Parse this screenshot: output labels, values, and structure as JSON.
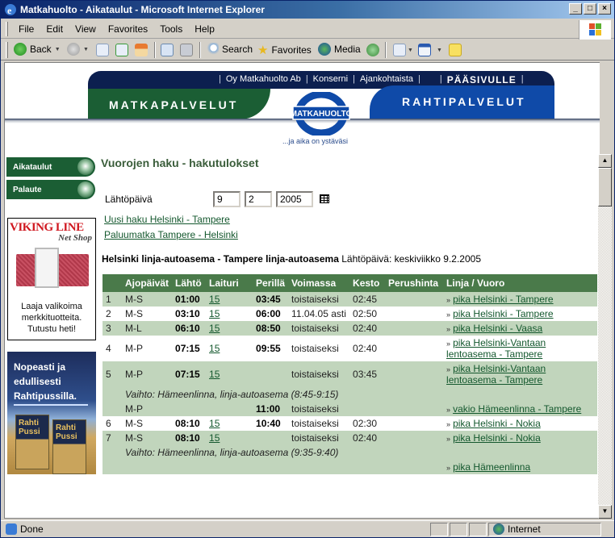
{
  "window": {
    "title": "Matkahuolto - Aikataulut - Microsoft Internet Explorer",
    "controls": [
      "_",
      "□",
      "×"
    ]
  },
  "menubar": {
    "items": [
      "File",
      "Edit",
      "View",
      "Favorites",
      "Tools",
      "Help"
    ]
  },
  "toolbar": {
    "back": "Back",
    "search": "Search",
    "favorites": "Favorites",
    "media": "Media"
  },
  "status": {
    "text": "Done",
    "zone": "Internet"
  },
  "header": {
    "links": [
      "|",
      "Oy Matkahuolto Ab",
      "|",
      "Konserni",
      "|",
      "Ajankohtaista",
      "|",
      "|",
      "PÄÄSIVULLE",
      "|"
    ],
    "left_tab": "MATKAPALVELUT",
    "right_tab": "RAHTIPALVELUT",
    "logo_text": "MATKAHUOLTO",
    "tagline": "...ja aika on ystäväsi"
  },
  "sidebar": {
    "items": [
      {
        "label": "Aikataulut"
      },
      {
        "label": "Palaute"
      }
    ],
    "ad_viking": {
      "brand": "VIKING LINE",
      "sub": "Net Shop",
      "text_lines": [
        "Laaja valikoima",
        "merkkituotteita.",
        "Tutustu heti!"
      ]
    },
    "ad_rahti": {
      "text_lines": [
        "Nopeasti ja",
        "edullisesti",
        "Rahtipussilla."
      ],
      "bag_label": "Rahti Pussi"
    }
  },
  "main": {
    "title": "Vuorojen haku - hakutulokset",
    "date_label": "Lähtöpäivä",
    "date": {
      "day": "9",
      "month": "2",
      "year": "2005"
    },
    "links": [
      "Uusi haku Helsinki - Tampere",
      "Paluumatka Tampere - Helsinki"
    ],
    "route_bold": "Helsinki linja-autoasema - Tampere linja-autoasema",
    "route_rest": " Lähtöpäivä: keskiviikko 9.2.2005",
    "table": {
      "headers": [
        "",
        "Ajopäivät",
        "Lähtö",
        "Laituri",
        "Perillä",
        "Voimassa",
        "Kesto",
        "Perushinta",
        "Linja / Vuoro"
      ],
      "rows": [
        {
          "n": "1",
          "days": "M-S",
          "dep": "01:00",
          "plat": "15",
          "arr": "03:45",
          "valid": "toistaiseksi",
          "dur": "02:45",
          "price": "",
          "line": "pika Helsinki - Tampere"
        },
        {
          "n": "2",
          "days": "M-S",
          "dep": "03:10",
          "plat": "15",
          "arr": "06:00",
          "valid": "11.04.05 asti",
          "dur": "02:50",
          "price": "",
          "line": "pika Helsinki - Tampere"
        },
        {
          "n": "3",
          "days": "M-L",
          "dep": "06:10",
          "plat": "15",
          "arr": "08:50",
          "valid": "toistaiseksi",
          "dur": "02:40",
          "price": "",
          "line": "pika Helsinki - Vaasa"
        },
        {
          "n": "4",
          "days": "M-P",
          "dep": "07:15",
          "plat": "15",
          "arr": "09:55",
          "valid": "toistaiseksi",
          "dur": "02:40",
          "price": "",
          "line": "pika Helsinki-Vantaan lentoasema - Tampere"
        },
        {
          "n": "5",
          "days": "M-P",
          "dep": "07:15",
          "plat": "15",
          "arr": "",
          "valid": "toistaiseksi",
          "dur": "03:45",
          "price": "",
          "line": "pika Helsinki-Vantaan lentoasema - Tampere"
        },
        {
          "note": "Vaihto: Hämeenlinna, linja-autoasema (8:45-9:15)"
        },
        {
          "n": "",
          "days": "M-P",
          "dep": "",
          "plat": "",
          "arr": "11:00",
          "valid": "toistaiseksi",
          "dur": "",
          "price": "",
          "line": "vakio Hämeenlinna - Tampere"
        },
        {
          "n": "6",
          "days": "M-S",
          "dep": "08:10",
          "plat": "15",
          "arr": "10:40",
          "valid": "toistaiseksi",
          "dur": "02:30",
          "price": "",
          "line": "pika Helsinki - Nokia"
        },
        {
          "n": "7",
          "days": "M-S",
          "dep": "08:10",
          "plat": "15",
          "arr": "",
          "valid": "toistaiseksi",
          "dur": "02:40",
          "price": "",
          "line": "pika Helsinki - Nokia"
        },
        {
          "note": "Vaihto: Hämeenlinna, linja-autoasema (9:35-9:40)"
        },
        {
          "n": "",
          "days": "",
          "dep": "",
          "plat": "",
          "arr": "",
          "valid": "",
          "dur": "",
          "price": "",
          "line": "pika Hämeenlinna"
        }
      ]
    }
  },
  "colors": {
    "green": "#1b5e34",
    "navy": "#0c1f4f",
    "blue": "#0f4aa8",
    "table_header": "#4a7a4a",
    "row_green": "#c1d5bc",
    "link": "#14582e"
  }
}
